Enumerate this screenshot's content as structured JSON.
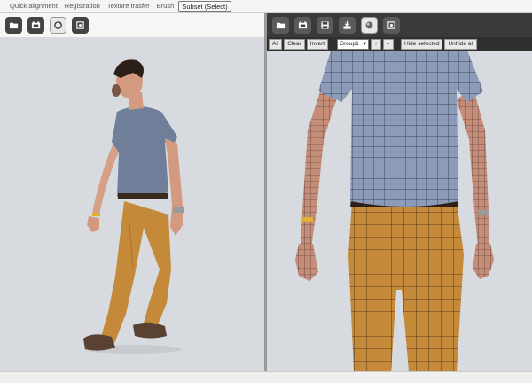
{
  "tabs": [
    {
      "label": "Quick alignment"
    },
    {
      "label": "Registration"
    },
    {
      "label": "Texture trasfer"
    },
    {
      "label": "Brush"
    },
    {
      "label": "Subset (Select)",
      "active": true
    }
  ],
  "left_toolbar": {
    "icons": [
      "folder-icon",
      "film-icon",
      "rotate-icon",
      "target-icon"
    ]
  },
  "right_toolbar": {
    "icons": [
      "folder-icon",
      "film-icon",
      "save-icon",
      "download-icon",
      "sphere-icon",
      "target-icon"
    ]
  },
  "selection_bar": {
    "all_label": "All",
    "clear_label": "Clear",
    "invert_label": "Invert",
    "group_value": "Group1",
    "plus_label": "+",
    "minus_label": "-",
    "hide_selected_label": "Hide selected",
    "unhide_all_label": "Unhide all"
  },
  "colors": {
    "viewport_bg": "#d7dadf",
    "shirt": "#6f7f9a",
    "pants": "#c48a3a",
    "skin": "#d39a80"
  }
}
